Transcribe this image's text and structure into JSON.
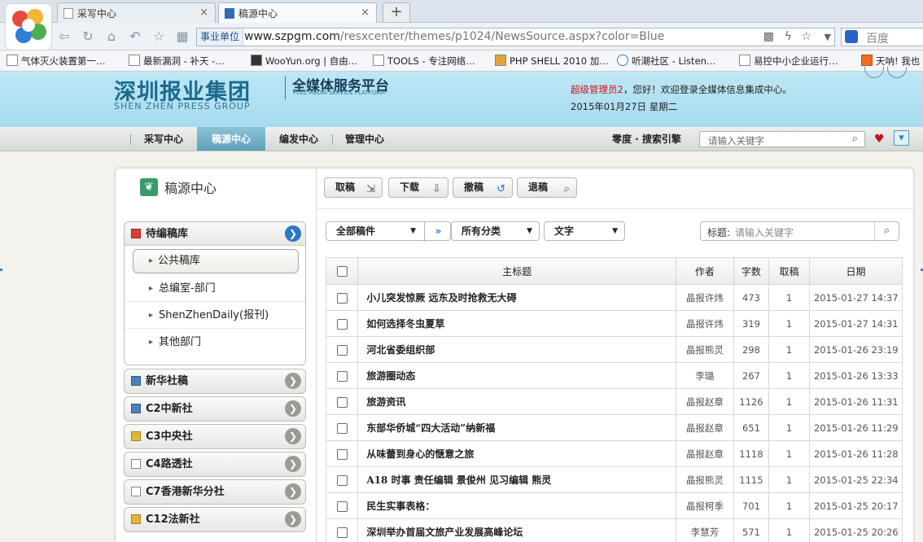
{
  "browser": {
    "tabs": [
      {
        "label": "采写中心",
        "close": "×"
      },
      {
        "label": "稿源中心",
        "close": "×"
      }
    ],
    "new_tab": "+",
    "address": {
      "badge": "事业单位",
      "url_host": "www.szpgm.com",
      "url_path": "/resxcenter/themes/p1024/NewsSource.aspx?color=Blue"
    },
    "search_placeholder": "百度",
    "bookmarks": [
      "气体灭火装置第一…",
      "最新漏洞 - 补天 -…",
      "WooYun.org | 自由…",
      "TOOLS - 专注网络…",
      "PHP SHELL 2010 加…",
      "听潮社区 - Listen…",
      "易控中小企业运行…",
      "天呐! 我也"
    ]
  },
  "header": {
    "logo_cn": "深圳报业集团",
    "logo_en": "SHEN ZHEN PRESS GROUP",
    "platform_cn": "全媒体服务平台",
    "platform_en": "FULL MEDIA SERVICE PLATFORM",
    "admin_name": "超级管理员2",
    "welcome_rest": "，您好！欢迎登录全媒体信息集成中心。",
    "date": "2015年01月27日  星期二"
  },
  "nav": {
    "items": [
      "采写中心",
      "稿源中心",
      "编发中心",
      "管理中心"
    ],
    "active": 1,
    "engine_label": "零度 · 搜索引擎",
    "search_placeholder": "请输入关键字"
  },
  "sidebar": {
    "title": "稿源中心",
    "open_group": {
      "label": "待编稿库",
      "items": [
        "公共稿库",
        "总编室-部门",
        "ShenZhenDaily(报刊)",
        "其他部门"
      ]
    },
    "groups": [
      "新华社稿",
      "C2中新社",
      "C3中央社",
      "C4路透社",
      "C7香港新华分社",
      "C12法新社"
    ]
  },
  "toolbar": {
    "buttons": [
      "取稿",
      "下载",
      "撤稿",
      "退稿"
    ]
  },
  "filters": {
    "scope": "全部稿件",
    "category": "所有分类",
    "type": "文字",
    "title_label": "标题:",
    "title_placeholder": "请输入关键字"
  },
  "table": {
    "headers": [
      "主标题",
      "作者",
      "字数",
      "取稿",
      "日期"
    ],
    "rows": [
      {
        "title": "小儿突发惊厥 远东及时抢救无大碍",
        "author": "晶报许炜",
        "words": "473",
        "taken": "1",
        "date": "2015-01-27 14:37"
      },
      {
        "title": "如何选择冬虫夏草",
        "author": "晶报许炜",
        "words": "319",
        "taken": "1",
        "date": "2015-01-27 14:31"
      },
      {
        "title": "河北省委组织部",
        "author": "晶报熊灵",
        "words": "298",
        "taken": "1",
        "date": "2015-01-26 23:19"
      },
      {
        "title": "旅游圈动态",
        "author": "李璐",
        "words": "267",
        "taken": "1",
        "date": "2015-01-26 13:33"
      },
      {
        "title": "旅游资讯",
        "author": "晶报赵章",
        "words": "1126",
        "taken": "1",
        "date": "2015-01-26 11:31"
      },
      {
        "title": "东部华侨城“四大活动”纳新福",
        "author": "晶报赵章",
        "words": "651",
        "taken": "1",
        "date": "2015-01-26 11:29"
      },
      {
        "title": "从味蕾到身心的惬意之旅",
        "author": "晶报赵章",
        "words": "1118",
        "taken": "1",
        "date": "2015-01-26 11:28"
      },
      {
        "title": "A18 时事 责任编辑 景俊州 见习编辑 熊灵",
        "author": "晶报熊灵",
        "words": "1115",
        "taken": "1",
        "date": "2015-01-25 22:34"
      },
      {
        "title": "民生实事表格：",
        "author": "晶报柯季",
        "words": "701",
        "taken": "1",
        "date": "2015-01-25 20:17"
      },
      {
        "title": "深圳举办首届文旅产业发展高峰论坛",
        "author": "李慧芳",
        "words": "571",
        "taken": "1",
        "date": "2015-01-25 20:26"
      }
    ]
  }
}
